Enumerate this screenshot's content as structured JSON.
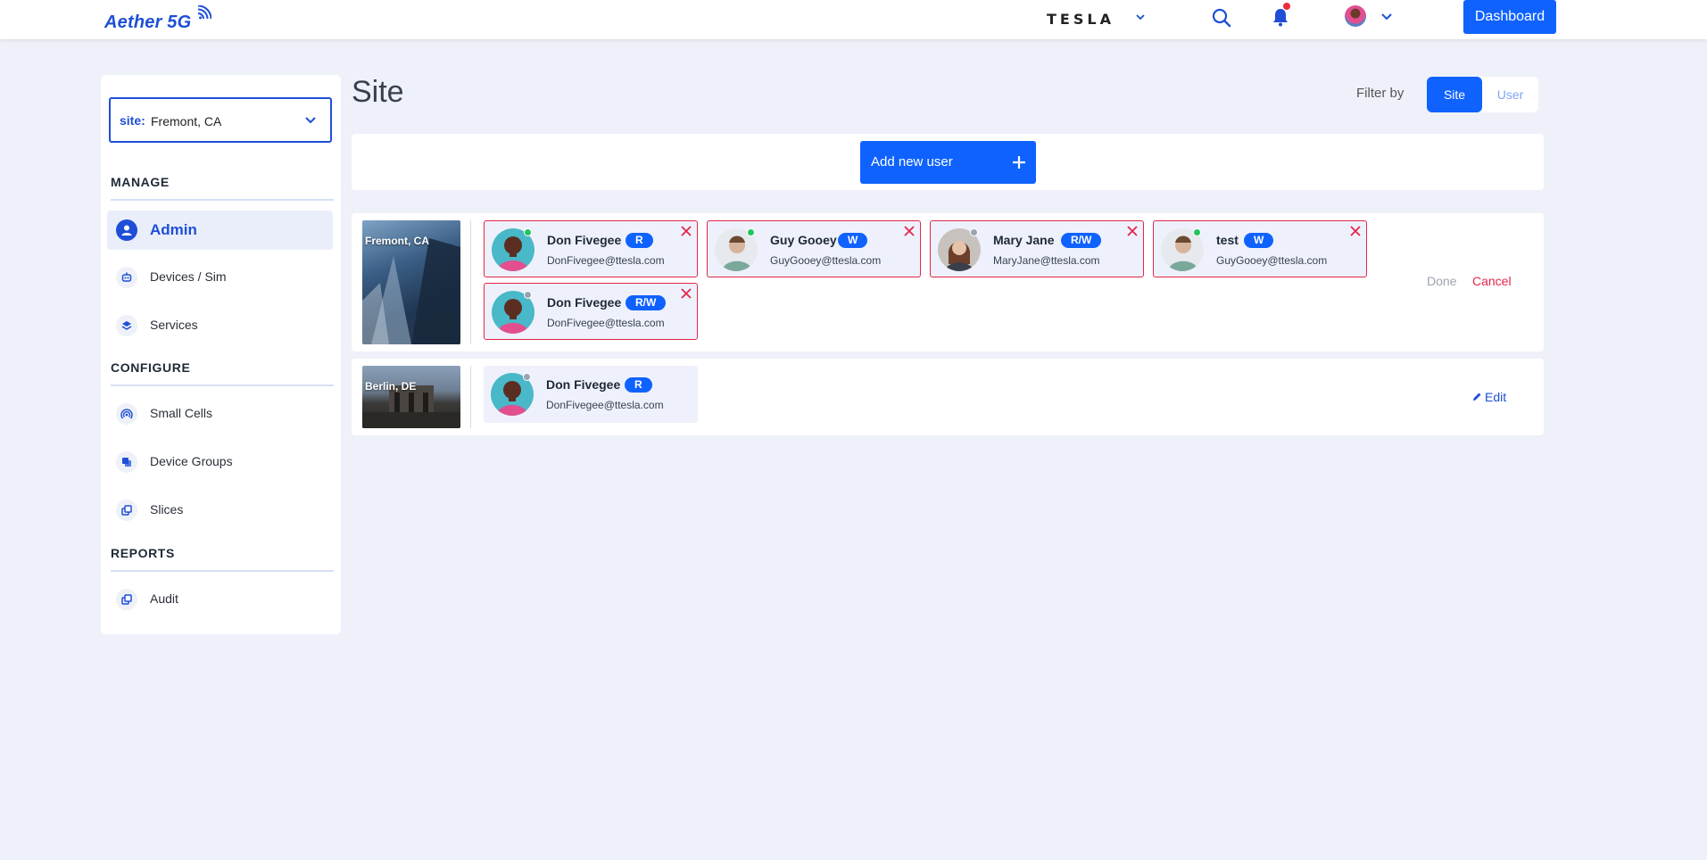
{
  "header": {
    "logo": "Aether 5G",
    "org": "TESLA",
    "dashboard_label": "Dashboard"
  },
  "sidebar": {
    "site_select": {
      "label": "site:",
      "value": "Fremont, CA"
    },
    "sections": [
      {
        "title": "MANAGE",
        "items": [
          {
            "label": "Admin",
            "icon": "person-icon",
            "active": true
          },
          {
            "label": "Devices / Sim",
            "icon": "robot-icon"
          },
          {
            "label": "Services",
            "icon": "layers-icon"
          }
        ]
      },
      {
        "title": "CONFIGURE",
        "items": [
          {
            "label": "Small Cells",
            "icon": "signal-icon"
          },
          {
            "label": "Device Groups",
            "icon": "group-icon"
          },
          {
            "label": "Slices",
            "icon": "slices-icon"
          }
        ]
      },
      {
        "title": "REPORTS",
        "items": [
          {
            "label": "Audit",
            "icon": "audit-icon"
          }
        ]
      }
    ]
  },
  "main": {
    "title": "Site",
    "filter": {
      "label": "Filter by",
      "options": [
        "Site",
        "User"
      ],
      "selected": "Site"
    },
    "add_user_label": "Add new user",
    "sites": [
      {
        "name": "Fremont, CA",
        "editing": true,
        "done_label": "Done",
        "cancel_label": "Cancel",
        "users": [
          {
            "name": "Don Fivegee",
            "role": "R",
            "email": "DonFivegee@ttesla.com",
            "online": true
          },
          {
            "name": "Guy Gooey",
            "role": "W",
            "email": "GuyGooey@ttesla.com",
            "online": true
          },
          {
            "name": "Mary Jane",
            "role": "R/W",
            "email": "MaryJane@ttesla.com",
            "online": false
          },
          {
            "name": "test",
            "role": "W",
            "email": "GuyGooey@ttesla.com",
            "online": true
          },
          {
            "name": "Don Fivegee",
            "role": "R/W",
            "email": "DonFivegee@ttesla.com",
            "online": false
          }
        ]
      },
      {
        "name": "Berlin, DE",
        "editing": false,
        "edit_label": "Edit",
        "users": [
          {
            "name": "Don Fivegee",
            "role": "R",
            "email": "DonFivegee@ttesla.com",
            "online": false
          }
        ]
      }
    ]
  }
}
